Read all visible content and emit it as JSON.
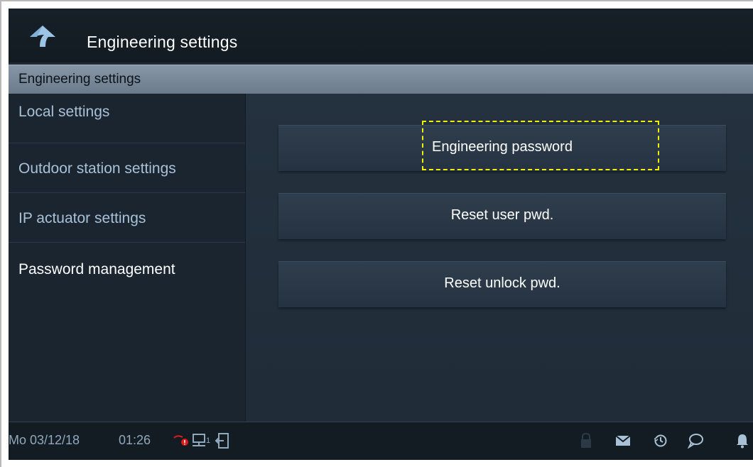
{
  "window": {
    "title": "Engineering settings"
  },
  "section": {
    "title": "Engineering settings"
  },
  "sidebar": {
    "items": [
      {
        "label": "Local settings",
        "active": false
      },
      {
        "label": "Outdoor station settings",
        "active": false
      },
      {
        "label": "IP actuator settings",
        "active": false
      },
      {
        "label": "Password management",
        "active": true
      }
    ]
  },
  "main": {
    "buttons": [
      {
        "label": "Engineering password",
        "focused": true
      },
      {
        "label": "Reset user pwd.",
        "focused": false
      },
      {
        "label": "Reset unlock pwd.",
        "focused": false
      }
    ]
  },
  "statusbar": {
    "date": "Mo 03/12/18",
    "time": "01:26",
    "network_index": "1",
    "icons": [
      "lan-alert-icon",
      "network-icon",
      "exit-icon",
      "lock-icon",
      "mail-icon",
      "history-icon",
      "message-icon",
      "bell-icon"
    ]
  },
  "colors": {
    "background": "#1f2a35",
    "section_header": "#7a8a9a",
    "sidebar_text": "#a9c1d6",
    "active_text": "#ffffff",
    "focus": "#f2f000",
    "alert": "#e01818",
    "back_icon": "#9cc4e4"
  }
}
